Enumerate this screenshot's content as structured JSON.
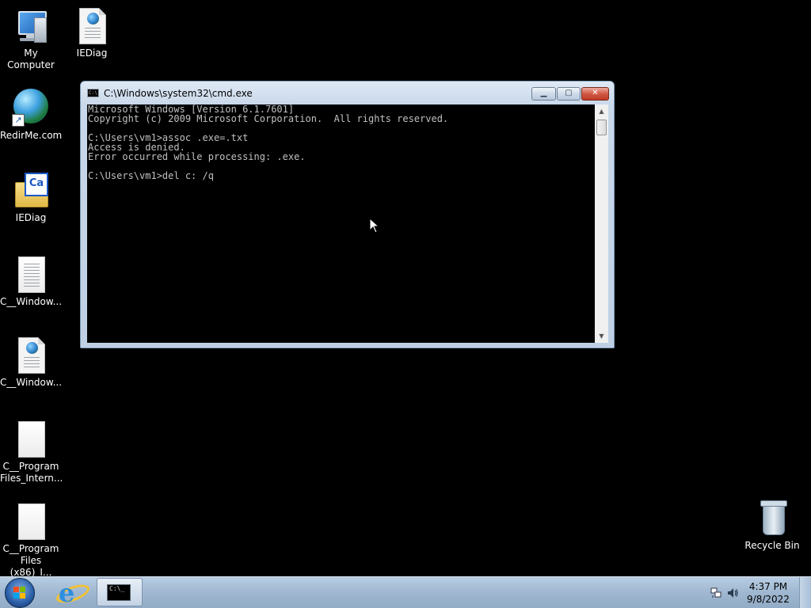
{
  "desktop": {
    "icons": [
      {
        "label": "My Computer",
        "icon": "computer-icon"
      },
      {
        "label": "IEDiag",
        "icon": "document-globe-icon"
      },
      {
        "label": "RedirMe.com",
        "icon": "globe-shortcut-icon"
      },
      {
        "label": "IEDiag",
        "icon": "folder-ca-icon"
      },
      {
        "label": "C__Window...",
        "icon": "blank-document-icon"
      },
      {
        "label": "C__Window...",
        "icon": "document-globe-icon"
      },
      {
        "label": "C__Program Files_Intern...",
        "icon": "blank-document-icon"
      },
      {
        "label": "C__Program Files (x86)_I...",
        "icon": "blank-document-icon"
      },
      {
        "label": "Recycle Bin",
        "icon": "recycle-bin-icon"
      }
    ]
  },
  "cmd_window": {
    "title": "C:\\Windows\\system32\\cmd.exe",
    "lines": [
      "Microsoft Windows [Version 6.1.7601]",
      "Copyright (c) 2009 Microsoft Corporation.  All rights reserved.",
      "",
      "C:\\Users\\vm1>assoc .exe=.txt",
      "Access is denied.",
      "Error occurred while processing: .exe.",
      "",
      "C:\\Users\\vm1>del c: /q"
    ],
    "colors": {
      "background": "#000000",
      "text": "#c0c0c0"
    }
  },
  "taskbar": {
    "pinned": [
      {
        "name": "start-button",
        "icon": "windows-flag-icon"
      },
      {
        "name": "internet-explorer",
        "icon": "ie-icon"
      },
      {
        "name": "cmd-task",
        "icon": "cmd-icon"
      }
    ],
    "clock": {
      "time": "4:37 PM",
      "date": "9/8/2022"
    }
  }
}
